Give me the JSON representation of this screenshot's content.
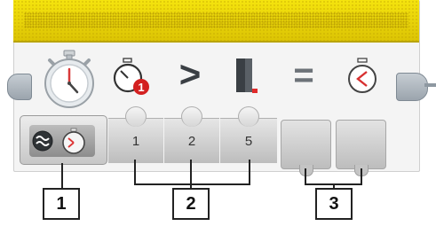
{
  "block": {
    "operator_symbol": ">",
    "equals_symbol": "=",
    "inputs": [
      {
        "value": "1"
      },
      {
        "value": "2"
      },
      {
        "value": "5"
      }
    ]
  },
  "callouts": [
    {
      "label": "1"
    },
    {
      "label": "2"
    },
    {
      "label": "3"
    }
  ],
  "colors": {
    "header_yellow": "#f3e20a",
    "accent_red": "#e03030",
    "block_gray": "#f4f4f4"
  },
  "icons": {
    "main": "stopwatch-icon",
    "mode": "wait-timer-compare-icon",
    "param1": "timer-number-icon",
    "param3": "duration-icon",
    "output": "timer-output-icon"
  }
}
